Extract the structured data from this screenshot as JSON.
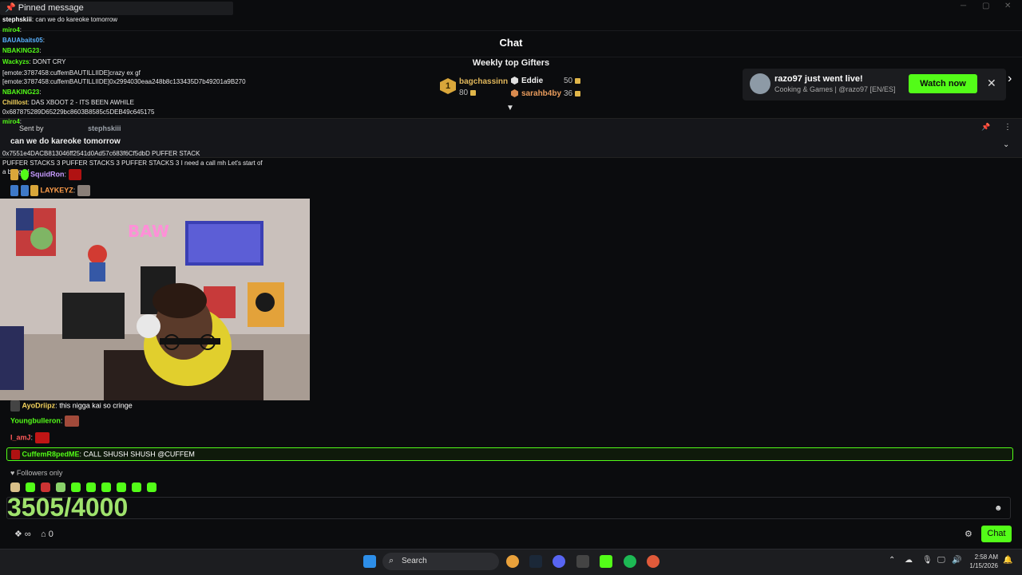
{
  "pinned_banner": {
    "label": "Pinned message"
  },
  "header": {
    "title": "Chat"
  },
  "gifters": {
    "title": "Weekly top Gifters",
    "rank1": {
      "rank": "1",
      "name": "bagchassinn",
      "amount": "80"
    },
    "rank2": {
      "name": "Eddie",
      "amount": "50"
    },
    "rank3": {
      "name": "sarahb4by",
      "amount": "36"
    }
  },
  "notification": {
    "title": "razo97 just went live!",
    "subtitle": "Cooking & Games | @razo97 [EN/ES]",
    "watch_label": "Watch now"
  },
  "pinned": {
    "sent_by_label": "Sent by",
    "user": "stephskiii",
    "text": "can we do kareoke tomorrow"
  },
  "overlay_chat": [
    {
      "user": "stephskiii",
      "text": "can we do kareoke tomorrow",
      "color": "#fff"
    },
    {
      "user": "miro4",
      "text": "",
      "color": "#53fc18"
    },
    {
      "user": "BAUAbaits05",
      "text": "",
      "color": "#5ab2ff"
    },
    {
      "user": "NBAKING23",
      "text": "",
      "color": "#53fc18"
    },
    {
      "user": "Wackyzs",
      "text": "DONT CRY",
      "color": "#53fc18"
    },
    {
      "user": "",
      "text": "[emote:3787458:cuffemBAUTILLIIDE]crazy ex gf",
      "color": "#fff"
    },
    {
      "user": "",
      "text": "[emote:3787458:cuffemBAUTILLIIDE]0x2994030eaa248b8c133435D7b49201a9B270",
      "color": "#fff"
    },
    {
      "user": "NBAKING23",
      "text": "",
      "color": "#53fc18"
    },
    {
      "user": "Chilllost",
      "text": "DAS XBOOT 2 - ITS BEEN AWHILE",
      "color": "#f2d15c"
    },
    {
      "user": "",
      "text": "0x687875289D65229bc8603B8585c5DEB49c645175",
      "color": "#fff"
    },
    {
      "user": "miro4",
      "text": "",
      "color": "#53fc18"
    },
    {
      "user": "",
      "text": "0x7551e4DACB813046ff2541d0Ad57c683f6Cf5dbD PUFFER STACK",
      "color": "#fff"
    },
    {
      "user": "",
      "text": "PUFFER STACKS 3 PUFFER STACKS 3 PUFFER STACKS 3 I need a call mh Let's start of",
      "color": "#fff"
    },
    {
      "user": "",
      "text": "a banger!",
      "color": "#fff"
    }
  ],
  "chat": {
    "squidron": {
      "user": "SquidRon",
      "sep": ":"
    },
    "laykeyz": {
      "user": "LAYKEYZ",
      "sep": ":"
    },
    "ayo": {
      "user": "AyoDriipz",
      "text": ": this nigga kai so cringe"
    },
    "young": {
      "user": "Youngbulleron",
      "sep": ":"
    },
    "iamj": {
      "user": "I_amJ",
      "sep": ":"
    },
    "highlight": {
      "user": "CuffemR8pedME",
      "text": ": CALL SHUSH SHUSH @CUFFEM"
    }
  },
  "footer": {
    "followers_only": "Followers only",
    "counter": "3505/4000",
    "points": "0",
    "chat_button": "Chat"
  },
  "taskbar": {
    "search": "Search",
    "time": "2:58 AM",
    "date": "1/15/2026"
  }
}
